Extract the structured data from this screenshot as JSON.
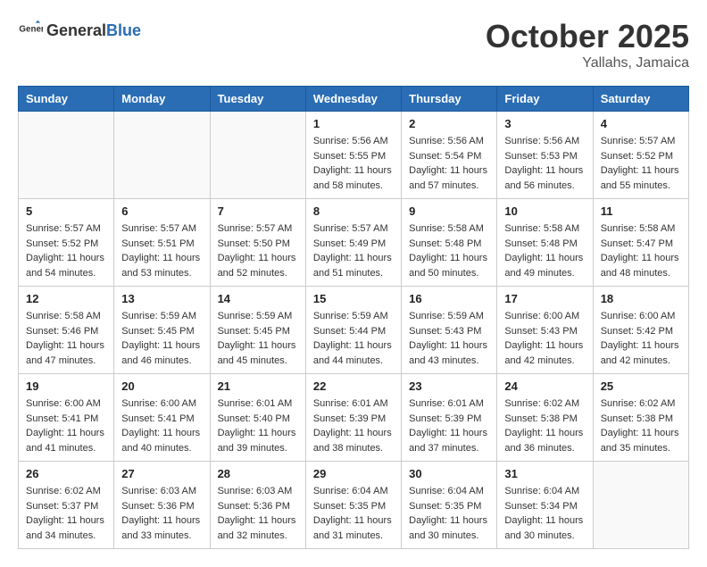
{
  "header": {
    "logo_general": "General",
    "logo_blue": "Blue",
    "month": "October 2025",
    "location": "Yallahs, Jamaica"
  },
  "days_of_week": [
    "Sunday",
    "Monday",
    "Tuesday",
    "Wednesday",
    "Thursday",
    "Friday",
    "Saturday"
  ],
  "weeks": [
    [
      {
        "day": "",
        "info": ""
      },
      {
        "day": "",
        "info": ""
      },
      {
        "day": "",
        "info": ""
      },
      {
        "day": "1",
        "info": "Sunrise: 5:56 AM\nSunset: 5:55 PM\nDaylight: 11 hours and 58 minutes."
      },
      {
        "day": "2",
        "info": "Sunrise: 5:56 AM\nSunset: 5:54 PM\nDaylight: 11 hours and 57 minutes."
      },
      {
        "day": "3",
        "info": "Sunrise: 5:56 AM\nSunset: 5:53 PM\nDaylight: 11 hours and 56 minutes."
      },
      {
        "day": "4",
        "info": "Sunrise: 5:57 AM\nSunset: 5:52 PM\nDaylight: 11 hours and 55 minutes."
      }
    ],
    [
      {
        "day": "5",
        "info": "Sunrise: 5:57 AM\nSunset: 5:52 PM\nDaylight: 11 hours and 54 minutes."
      },
      {
        "day": "6",
        "info": "Sunrise: 5:57 AM\nSunset: 5:51 PM\nDaylight: 11 hours and 53 minutes."
      },
      {
        "day": "7",
        "info": "Sunrise: 5:57 AM\nSunset: 5:50 PM\nDaylight: 11 hours and 52 minutes."
      },
      {
        "day": "8",
        "info": "Sunrise: 5:57 AM\nSunset: 5:49 PM\nDaylight: 11 hours and 51 minutes."
      },
      {
        "day": "9",
        "info": "Sunrise: 5:58 AM\nSunset: 5:48 PM\nDaylight: 11 hours and 50 minutes."
      },
      {
        "day": "10",
        "info": "Sunrise: 5:58 AM\nSunset: 5:48 PM\nDaylight: 11 hours and 49 minutes."
      },
      {
        "day": "11",
        "info": "Sunrise: 5:58 AM\nSunset: 5:47 PM\nDaylight: 11 hours and 48 minutes."
      }
    ],
    [
      {
        "day": "12",
        "info": "Sunrise: 5:58 AM\nSunset: 5:46 PM\nDaylight: 11 hours and 47 minutes."
      },
      {
        "day": "13",
        "info": "Sunrise: 5:59 AM\nSunset: 5:45 PM\nDaylight: 11 hours and 46 minutes."
      },
      {
        "day": "14",
        "info": "Sunrise: 5:59 AM\nSunset: 5:45 PM\nDaylight: 11 hours and 45 minutes."
      },
      {
        "day": "15",
        "info": "Sunrise: 5:59 AM\nSunset: 5:44 PM\nDaylight: 11 hours and 44 minutes."
      },
      {
        "day": "16",
        "info": "Sunrise: 5:59 AM\nSunset: 5:43 PM\nDaylight: 11 hours and 43 minutes."
      },
      {
        "day": "17",
        "info": "Sunrise: 6:00 AM\nSunset: 5:43 PM\nDaylight: 11 hours and 42 minutes."
      },
      {
        "day": "18",
        "info": "Sunrise: 6:00 AM\nSunset: 5:42 PM\nDaylight: 11 hours and 42 minutes."
      }
    ],
    [
      {
        "day": "19",
        "info": "Sunrise: 6:00 AM\nSunset: 5:41 PM\nDaylight: 11 hours and 41 minutes."
      },
      {
        "day": "20",
        "info": "Sunrise: 6:00 AM\nSunset: 5:41 PM\nDaylight: 11 hours and 40 minutes."
      },
      {
        "day": "21",
        "info": "Sunrise: 6:01 AM\nSunset: 5:40 PM\nDaylight: 11 hours and 39 minutes."
      },
      {
        "day": "22",
        "info": "Sunrise: 6:01 AM\nSunset: 5:39 PM\nDaylight: 11 hours and 38 minutes."
      },
      {
        "day": "23",
        "info": "Sunrise: 6:01 AM\nSunset: 5:39 PM\nDaylight: 11 hours and 37 minutes."
      },
      {
        "day": "24",
        "info": "Sunrise: 6:02 AM\nSunset: 5:38 PM\nDaylight: 11 hours and 36 minutes."
      },
      {
        "day": "25",
        "info": "Sunrise: 6:02 AM\nSunset: 5:38 PM\nDaylight: 11 hours and 35 minutes."
      }
    ],
    [
      {
        "day": "26",
        "info": "Sunrise: 6:02 AM\nSunset: 5:37 PM\nDaylight: 11 hours and 34 minutes."
      },
      {
        "day": "27",
        "info": "Sunrise: 6:03 AM\nSunset: 5:36 PM\nDaylight: 11 hours and 33 minutes."
      },
      {
        "day": "28",
        "info": "Sunrise: 6:03 AM\nSunset: 5:36 PM\nDaylight: 11 hours and 32 minutes."
      },
      {
        "day": "29",
        "info": "Sunrise: 6:04 AM\nSunset: 5:35 PM\nDaylight: 11 hours and 31 minutes."
      },
      {
        "day": "30",
        "info": "Sunrise: 6:04 AM\nSunset: 5:35 PM\nDaylight: 11 hours and 30 minutes."
      },
      {
        "day": "31",
        "info": "Sunrise: 6:04 AM\nSunset: 5:34 PM\nDaylight: 11 hours and 30 minutes."
      },
      {
        "day": "",
        "info": ""
      }
    ]
  ]
}
